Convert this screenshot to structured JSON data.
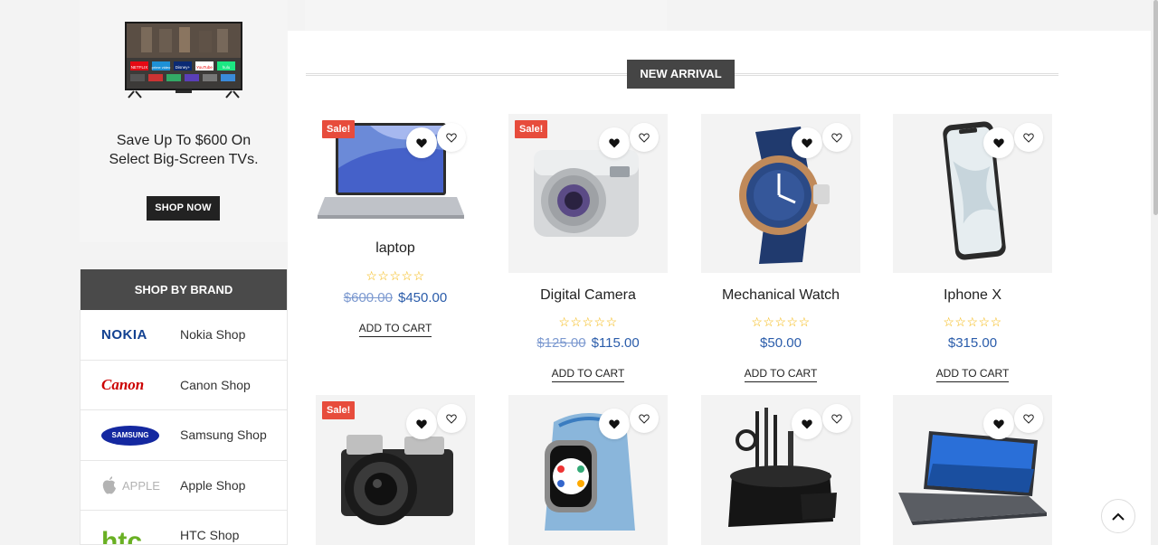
{
  "promo": {
    "line1": "Save Up To $600 On",
    "line2": "Select Big-Screen TVs.",
    "button": "SHOP NOW",
    "tv_apps": [
      "NETFLIX",
      "prime video",
      "Disney+",
      "hulu",
      "YouTube"
    ]
  },
  "brands": {
    "title": "SHOP BY BRAND",
    "items": [
      {
        "logo": "NOKIA",
        "label": "Nokia Shop",
        "color": "#124191"
      },
      {
        "logo": "Canon",
        "label": "Canon Shop",
        "color": "#cc0000"
      },
      {
        "logo": "SAMSUNG",
        "label": "Samsung Shop",
        "color": "#1428a0"
      },
      {
        "logo": "APPLE",
        "label": "Apple Shop",
        "color": "#b3b3b3"
      },
      {
        "logo": "htc",
        "label": "HTC Shop",
        "color": "#69b023"
      }
    ]
  },
  "section": {
    "title": "NEW ARRIVAL"
  },
  "products": [
    {
      "name": "laptop",
      "old_price": "$600.00",
      "price": "$450.00",
      "sale": "Sale!",
      "stars": "☆☆☆☆☆",
      "cart": "ADD TO CART"
    },
    {
      "name": "Digital Camera",
      "old_price": "$125.00",
      "price": "$115.00",
      "sale": "Sale!",
      "stars": "☆☆☆☆☆",
      "cart": "ADD TO CART"
    },
    {
      "name": "Mechanical Watch",
      "price": "$50.00",
      "stars": "☆☆☆☆☆",
      "cart": "ADD TO CART"
    },
    {
      "name": "Iphone X",
      "price": "$315.00",
      "stars": "☆☆☆☆☆",
      "cart": "ADD TO CART"
    }
  ],
  "products_row2": [
    {
      "sale": "Sale!",
      "image": "film-camera"
    },
    {
      "image": "smart-watch"
    },
    {
      "image": "desk-organizer"
    },
    {
      "image": "laptop"
    }
  ],
  "colors": {
    "accent": "#2a5caa",
    "sale": "#e74c3c",
    "star": "#f4b400",
    "dark": "#454545"
  }
}
